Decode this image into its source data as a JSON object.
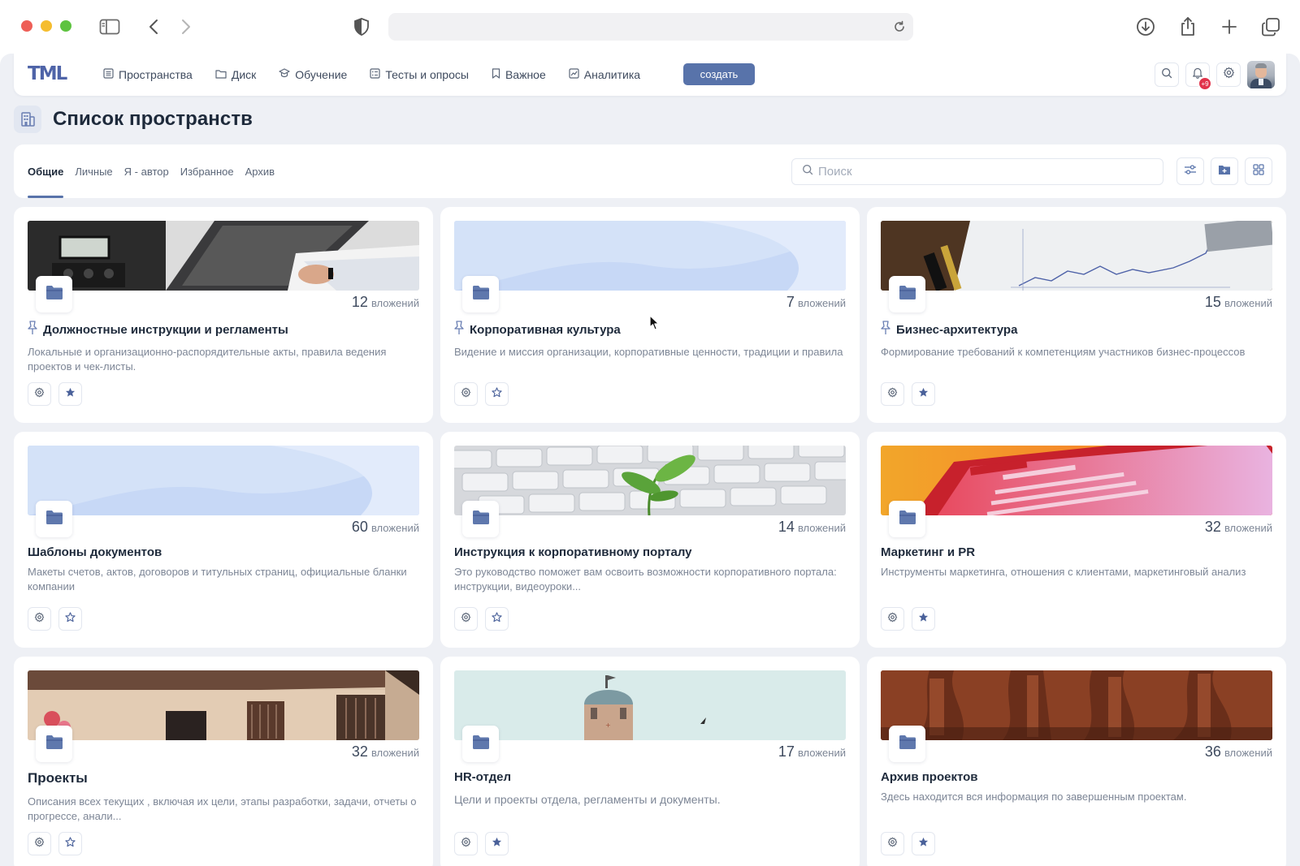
{
  "browser": {
    "icons": [
      "sidebar-icon",
      "back-icon",
      "forward-icon",
      "shield-icon",
      "reload-icon",
      "download-icon",
      "share-icon",
      "new-tab-icon",
      "tabs-icon"
    ]
  },
  "nav": {
    "logo": "TML",
    "items": [
      {
        "label": "Пространства",
        "icon": "list-icon"
      },
      {
        "label": "Диск",
        "icon": "folder-icon"
      },
      {
        "label": "Обучение",
        "icon": "graduation-cap-icon"
      },
      {
        "label": "Тесты и опросы",
        "icon": "checklist-icon"
      },
      {
        "label": "Важное",
        "icon": "bookmark-icon"
      },
      {
        "label": "Аналитика",
        "icon": "chart-icon"
      }
    ],
    "create_label": "создать",
    "notification_count": "+9",
    "accent_color": "#5873aa"
  },
  "page": {
    "title": "Список пространств"
  },
  "tabs": [
    {
      "label": "Общие",
      "active": true
    },
    {
      "label": "Личные",
      "active": false
    },
    {
      "label": "Я - автор",
      "active": false
    },
    {
      "label": "Избранное",
      "active": false
    },
    {
      "label": "Архив",
      "active": false
    }
  ],
  "search": {
    "placeholder": "Поиск"
  },
  "cards": [
    {
      "count": "12",
      "count_label": "вложений",
      "title": "Должностные инструкции и регламенты",
      "pinned": true,
      "favorite": true,
      "desc": "Локальные и организационно-распорядительные акты, правила ведения проектов и чек-листы."
    },
    {
      "count": "7",
      "count_label": "вложений",
      "title": "Корпоративная культура",
      "pinned": true,
      "favorite": false,
      "desc": "Видение и миссия организации, корпоративные ценности, традиции и правила"
    },
    {
      "count": "15",
      "count_label": "вложений",
      "title": "Бизнес-архитектура",
      "pinned": true,
      "favorite": true,
      "desc": "Формирование требований к компетенциям участников бизнес-процессов"
    },
    {
      "count": "60",
      "count_label": "вложений",
      "title": "Шаблоны документов",
      "pinned": false,
      "favorite": false,
      "desc": "Макеты счетов, актов, договоров и титульных страниц, официальные бланки компании"
    },
    {
      "count": "14",
      "count_label": "вложений",
      "title": "Инструкция к корпоративному порталу",
      "pinned": false,
      "favorite": false,
      "desc": "Это руководство поможет вам освоить возможности корпоративного портала: инструкции, видеоуроки..."
    },
    {
      "count": "32",
      "count_label": "вложений",
      "title": "Маркетинг и PR",
      "pinned": false,
      "favorite": true,
      "desc": "Инструменты маркетинга, отношения с клиентами, маркетинговый анализ"
    },
    {
      "count": "32",
      "count_label": "вложений",
      "title": "Проекты",
      "pinned": false,
      "favorite": false,
      "desc": "Описания всех текущих , включая их цели, этапы разработки, задачи, отчеты о прогрессе, анали..."
    },
    {
      "count": "17",
      "count_label": "вложений",
      "title": "HR-отдел",
      "pinned": false,
      "favorite": true,
      "desc": "Цели и проекты отдела, регламенты и документы."
    },
    {
      "count": "36",
      "count_label": "вложений",
      "title": "Архив проектов",
      "pinned": false,
      "favorite": true,
      "desc": "Здесь находится вся информация по завершенным проектам."
    }
  ]
}
